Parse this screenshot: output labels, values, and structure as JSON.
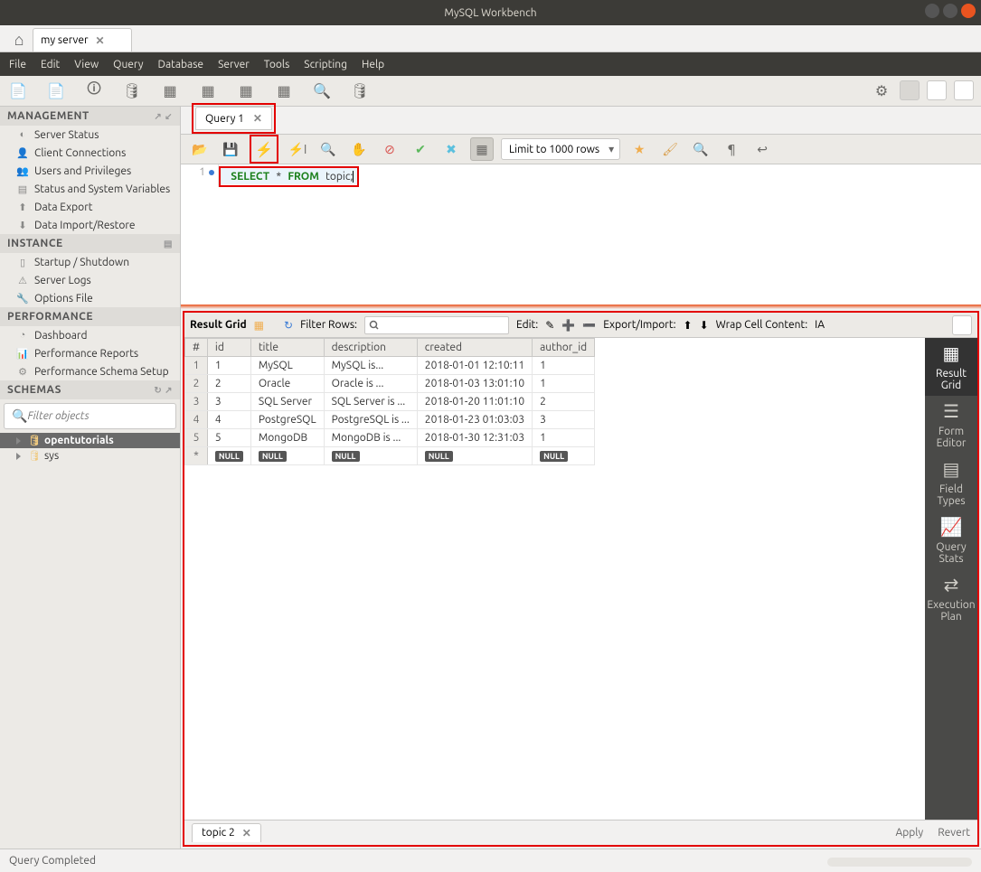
{
  "window": {
    "title": "MySQL Workbench"
  },
  "top_tab": {
    "label": "my server"
  },
  "menu": [
    "File",
    "Edit",
    "View",
    "Query",
    "Database",
    "Server",
    "Tools",
    "Scripting",
    "Help"
  ],
  "sidebar": {
    "sections": {
      "management": {
        "title": "MANAGEMENT",
        "items": [
          "Server Status",
          "Client Connections",
          "Users and Privileges",
          "Status and System Variables",
          "Data Export",
          "Data Import/Restore"
        ]
      },
      "instance": {
        "title": "INSTANCE",
        "items": [
          "Startup / Shutdown",
          "Server Logs",
          "Options File"
        ]
      },
      "performance": {
        "title": "PERFORMANCE",
        "items": [
          "Dashboard",
          "Performance Reports",
          "Performance Schema Setup"
        ]
      },
      "schemas": {
        "title": "SCHEMAS",
        "filter_placeholder": "Filter objects",
        "items": [
          "opentutorials",
          "sys"
        ]
      }
    }
  },
  "query_tab": {
    "label": "Query 1"
  },
  "editor": {
    "limit_label": "Limit to 1000 rows",
    "sql_line_no": "1",
    "sql": {
      "kw1": "SELECT",
      "star": "*",
      "kw2": "FROM",
      "ident": "topic",
      "semi": ";"
    }
  },
  "result": {
    "toolbar": {
      "grid_label": "Result Grid",
      "filter_label": "Filter Rows:",
      "edit_label": "Edit:",
      "export_label": "Export/Import:",
      "wrap_label": "Wrap Cell Content:"
    },
    "columns": [
      "#",
      "id",
      "title",
      "description",
      "created",
      "author_id"
    ],
    "rows": [
      {
        "n": "1",
        "id": "1",
        "title": "MySQL",
        "description": "MySQL is...",
        "created": "2018-01-01 12:10:11",
        "author_id": "1"
      },
      {
        "n": "2",
        "id": "2",
        "title": "Oracle",
        "description": "Oracle is ...",
        "created": "2018-01-03 13:01:10",
        "author_id": "1"
      },
      {
        "n": "3",
        "id": "3",
        "title": "SQL Server",
        "description": "SQL Server is ...",
        "created": "2018-01-20 11:01:10",
        "author_id": "2"
      },
      {
        "n": "4",
        "id": "4",
        "title": "PostgreSQL",
        "description": "PostgreSQL is ...",
        "created": "2018-01-23 01:03:03",
        "author_id": "3"
      },
      {
        "n": "5",
        "id": "5",
        "title": "MongoDB",
        "description": "MongoDB is ...",
        "created": "2018-01-30 12:31:03",
        "author_id": "1"
      }
    ],
    "null_label": "NULL",
    "bottom_tab": "topic 2",
    "apply": "Apply",
    "revert": "Revert"
  },
  "right_panel": [
    {
      "label": "Result Grid"
    },
    {
      "label": "Form Editor"
    },
    {
      "label": "Field Types"
    },
    {
      "label": "Query Stats"
    },
    {
      "label": "Execution Plan"
    }
  ],
  "status": {
    "text": "Query Completed"
  }
}
